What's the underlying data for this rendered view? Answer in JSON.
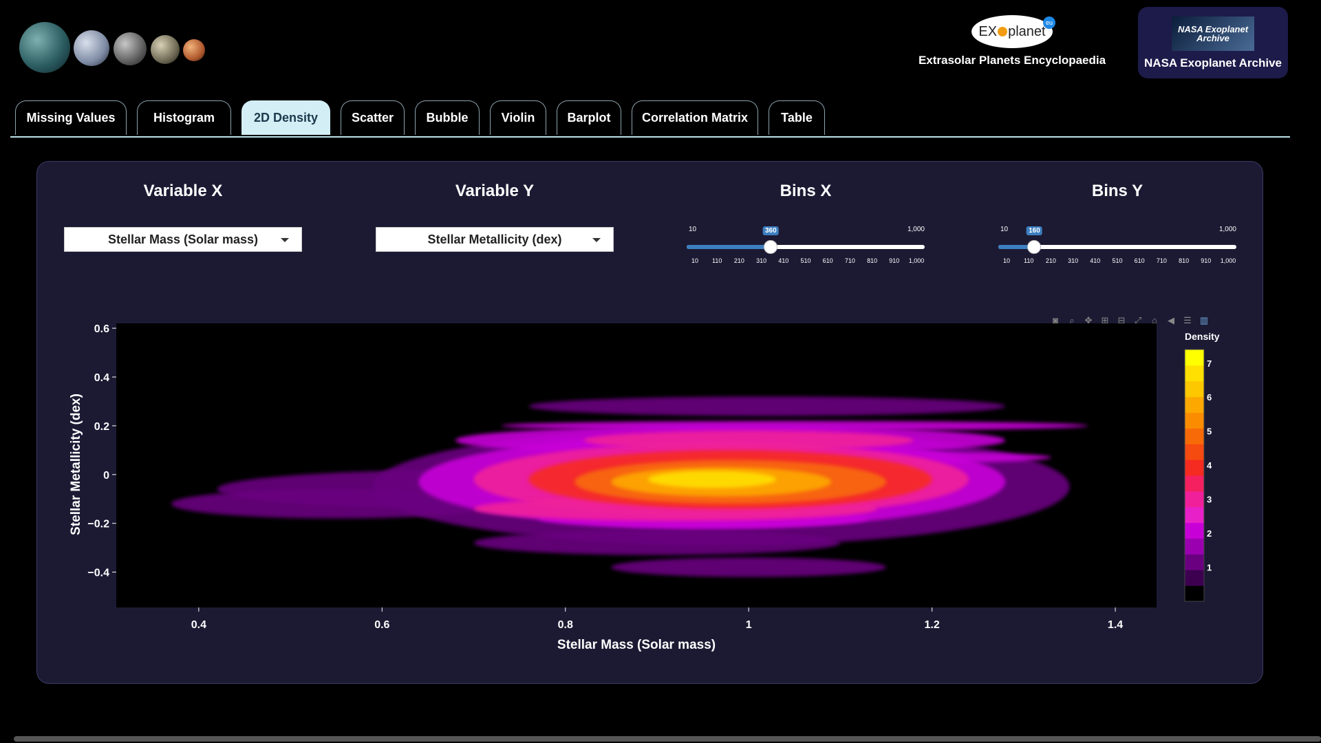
{
  "header": {
    "brands": [
      {
        "logo_text": "EX",
        "logo_text2": "planet",
        "logo_badge": "eu",
        "label": "Extrasolar Planets Encyclopaedia"
      },
      {
        "logo_text": "NASA Exoplanet Archive",
        "label": "NASA Exoplanet Archive"
      }
    ]
  },
  "tabs": [
    {
      "label": "Missing Values"
    },
    {
      "label": "Histogram"
    },
    {
      "label": "2D Density",
      "active": true
    },
    {
      "label": "Scatter"
    },
    {
      "label": "Bubble"
    },
    {
      "label": "Violin"
    },
    {
      "label": "Barplot"
    },
    {
      "label": "Correlation Matrix"
    },
    {
      "label": "Table"
    }
  ],
  "controls": {
    "variable_x": {
      "title": "Variable X",
      "value": "Stellar Mass (Solar mass)"
    },
    "variable_y": {
      "title": "Variable Y",
      "value": "Stellar Metallicity (dex)"
    },
    "bins_x": {
      "title": "Bins X",
      "min_label": "10",
      "max_label": "1,000",
      "value": 360,
      "value_label": "360",
      "min": 10,
      "max": 1000,
      "ticks": [
        "10",
        "110",
        "210",
        "310",
        "410",
        "510",
        "610",
        "710",
        "810",
        "910",
        "1,000"
      ]
    },
    "bins_y": {
      "title": "Bins Y",
      "min_label": "10",
      "max_label": "1,000",
      "value": 160,
      "value_label": "160",
      "min": 10,
      "max": 1000,
      "ticks": [
        "10",
        "110",
        "210",
        "310",
        "410",
        "510",
        "610",
        "710",
        "810",
        "910",
        "1,000"
      ]
    }
  },
  "modebar": {
    "icons": [
      "camera-icon",
      "zoom-icon",
      "pan-icon",
      "zoom-in-icon",
      "zoom-out-icon",
      "autoscale-icon",
      "reset-axes-icon",
      "spike-lines-icon",
      "compare-hover-icon",
      "plotly-logo-icon"
    ]
  },
  "chart_data": {
    "type": "heatmap",
    "subtype": "2d-density-contour",
    "xlabel": "Stellar Mass (Solar mass)",
    "ylabel": "Stellar Metallicity (dex)",
    "xlim": [
      0.31,
      1.445
    ],
    "ylim": [
      -0.545,
      0.62
    ],
    "x_ticks": [
      {
        "value": 0.4,
        "label": "0.4"
      },
      {
        "value": 0.6,
        "label": "0.6"
      },
      {
        "value": 0.8,
        "label": "0.8"
      },
      {
        "value": 1.0,
        "label": "1"
      },
      {
        "value": 1.2,
        "label": "1.2"
      },
      {
        "value": 1.4,
        "label": "1.4"
      }
    ],
    "y_ticks": [
      {
        "value": 0.6,
        "label": "0.6"
      },
      {
        "value": 0.4,
        "label": "0.4"
      },
      {
        "value": 0.2,
        "label": "0.2"
      },
      {
        "value": 0.0,
        "label": "0"
      },
      {
        "value": -0.2,
        "label": "−0.2"
      },
      {
        "value": -0.4,
        "label": "−0.4"
      }
    ],
    "colorbar": {
      "title": "Density",
      "range": [
        0,
        7.4
      ],
      "ticks": [
        {
          "value": 1,
          "label": "1"
        },
        {
          "value": 2,
          "label": "2"
        },
        {
          "value": 3,
          "label": "3"
        },
        {
          "value": 4,
          "label": "4"
        },
        {
          "value": 5,
          "label": "5"
        },
        {
          "value": 6,
          "label": "6"
        },
        {
          "value": 7,
          "label": "7"
        }
      ],
      "levels": [
        "#000000",
        "#3d0050",
        "#6a0080",
        "#9a00b0",
        "#c800d8",
        "#e820c8",
        "#f0209a",
        "#f42060",
        "#f52a20",
        "#f54a10",
        "#f86a08",
        "#fb8c00",
        "#fda800",
        "#fec800",
        "#ffe000",
        "#ffff00"
      ]
    },
    "density_blobs": [
      {
        "cx": 0.97,
        "cy": -0.05,
        "rx": 0.38,
        "ry": 0.24,
        "level": 1
      },
      {
        "cx": 0.96,
        "cy": -0.03,
        "rx": 0.32,
        "ry": 0.19,
        "level": 2
      },
      {
        "cx": 0.97,
        "cy": -0.02,
        "rx": 0.27,
        "ry": 0.15,
        "level": 3
      },
      {
        "cx": 0.98,
        "cy": -0.02,
        "rx": 0.22,
        "ry": 0.12,
        "level": 4
      },
      {
        "cx": 0.98,
        "cy": -0.03,
        "rx": 0.17,
        "ry": 0.09,
        "level": 5
      },
      {
        "cx": 0.97,
        "cy": -0.03,
        "rx": 0.12,
        "ry": 0.06,
        "level": 6
      },
      {
        "cx": 0.96,
        "cy": -0.02,
        "rx": 0.07,
        "ry": 0.035,
        "level": 7
      },
      {
        "cx": 0.7,
        "cy": -0.06,
        "rx": 0.28,
        "ry": 0.08,
        "level": 1
      },
      {
        "cx": 0.55,
        "cy": -0.12,
        "rx": 0.18,
        "ry": 0.06,
        "level": 1
      },
      {
        "cx": 0.98,
        "cy": 0.14,
        "rx": 0.3,
        "ry": 0.06,
        "level": 2
      },
      {
        "cx": 1.05,
        "cy": 0.2,
        "rx": 0.32,
        "ry": 0.02,
        "level": 2
      },
      {
        "cx": 1.0,
        "cy": 0.14,
        "rx": 0.18,
        "ry": 0.04,
        "level": 3
      },
      {
        "cx": 1.05,
        "cy": 0.07,
        "rx": 0.28,
        "ry": 0.03,
        "level": 2
      },
      {
        "cx": 1.02,
        "cy": 0.28,
        "rx": 0.26,
        "ry": 0.04,
        "level": 1
      },
      {
        "cx": 0.9,
        "cy": -0.28,
        "rx": 0.2,
        "ry": 0.05,
        "level": 1
      },
      {
        "cx": 0.92,
        "cy": -0.14,
        "rx": 0.22,
        "ry": 0.05,
        "level": 3
      },
      {
        "cx": 0.95,
        "cy": -0.18,
        "rx": 0.18,
        "ry": 0.04,
        "level": 2
      },
      {
        "cx": 1.0,
        "cy": -0.38,
        "rx": 0.15,
        "ry": 0.04,
        "level": 1
      }
    ]
  }
}
